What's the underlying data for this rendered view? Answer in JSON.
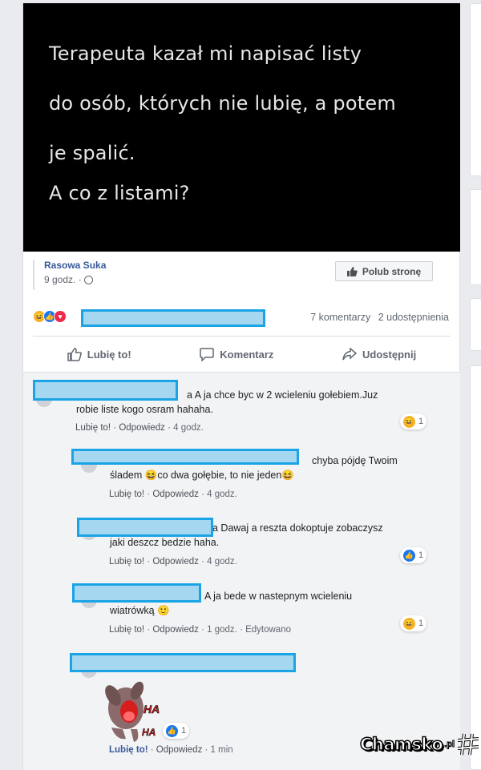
{
  "post": {
    "image_text": [
      "Terapeuta kazał mi napisać listy",
      "do osób, których nie lubię, a potem",
      "je spalić.",
      "A co z listami?"
    ],
    "page_name": "Rasowa Suka",
    "time": "9 godz. ·",
    "like_page_label": "Polub stronę",
    "comments_count": "7 komentarzy",
    "shares_count": "2 udostępnienia",
    "actions": {
      "like": "Lubię to!",
      "comment": "Komentarz",
      "share": "Udostępnij"
    }
  },
  "comments": [
    {
      "text_line1": "a A ja chce byc w 2 wcieleniu gołebiem.Juz",
      "text_line2": "robie liste kogo osram hahaha.",
      "like": "Lubię to!",
      "reply": "Odpowiedz",
      "time": "· 4 godz.",
      "react_count": "1",
      "react_type": "haha"
    },
    {
      "text_line1": "chyba pójdę Twoim",
      "text_line2a": "śladem",
      "text_line2b": "co dwa gołębie, to nie jeden",
      "like": "Lubię to!",
      "reply": "Odpowiedz",
      "time": "· 4 godz."
    },
    {
      "text_line1": "a Dawaj a reszta dokoptuje zobaczysz",
      "text_line2": "jaki deszcz bedzie haha.",
      "like": "Lubię to!",
      "reply": "Odpowiedz",
      "time": "· 4 godz.",
      "react_count": "1",
      "react_type": "like"
    },
    {
      "text_line1": "A ja bede w nastepnym wcieleniu",
      "text_line2": "wiatrówką",
      "like": "Lubię to!",
      "reply": "Odpowiedz",
      "time": "· 1 godz.",
      "edited": "· Edytowano",
      "react_count": "1",
      "react_type": "haha"
    },
    {
      "like": "Lubię to!",
      "reply": "Odpowiedz",
      "time": "· 1 min",
      "react_count": "1",
      "react_type": "like",
      "sticker_text": "HA HA"
    }
  ],
  "watermark": {
    "name": "Chamsko",
    "suffix": ".pl"
  },
  "colors": {
    "redaction_fill": "#a6d7f0",
    "redaction_border": "#1ba4e5",
    "link_blue": "#385898",
    "like_blue": "#1877f2"
  }
}
